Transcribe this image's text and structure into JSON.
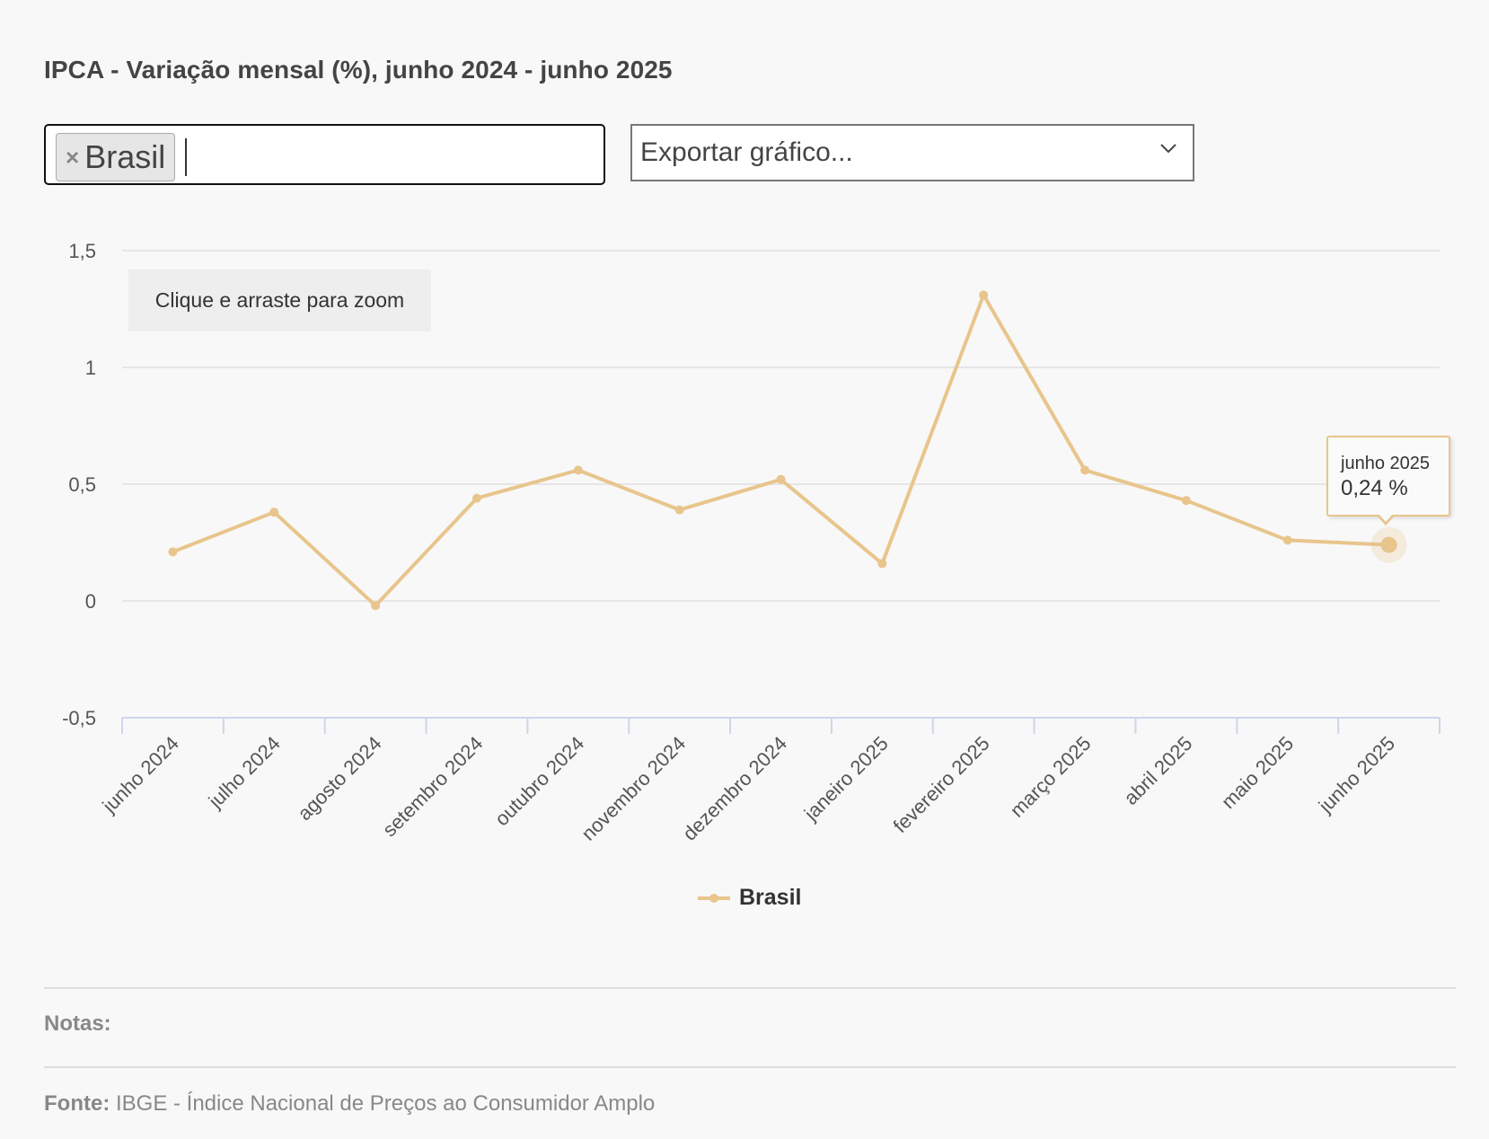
{
  "title": "IPCA - Variação mensal (%), junho 2024 - junho 2025",
  "filter": {
    "remove_glyph": "×",
    "selected_tag": "Brasil"
  },
  "export": {
    "label": "Exportar gráfico..."
  },
  "zoom_hint": "Clique e arraste para zoom",
  "tooltip": {
    "month": "junho 2025",
    "value": "0,24 %"
  },
  "legend": {
    "label": "Brasil"
  },
  "notes_label": "Notas:",
  "source": {
    "label": "Fonte:",
    "text": "IBGE - Índice Nacional de Preços ao Consumidor Amplo"
  },
  "colors": {
    "series": "#e8c58c",
    "grid": "#e6e6e6",
    "axis": "#ccd6eb"
  },
  "chart_data": {
    "type": "line",
    "title": "IPCA - Variação mensal (%), junho 2024 - junho 2025",
    "categories": [
      "junho 2024",
      "julho 2024",
      "agosto 2024",
      "setembro 2024",
      "outubro 2024",
      "novembro 2024",
      "dezembro 2024",
      "janeiro 2025",
      "fevereiro 2025",
      "março 2025",
      "abril 2025",
      "maio 2025",
      "junho 2025"
    ],
    "series": [
      {
        "name": "Brasil",
        "values": [
          0.21,
          0.38,
          -0.02,
          0.44,
          0.56,
          0.39,
          0.52,
          0.16,
          1.31,
          0.56,
          0.43,
          0.26,
          0.24
        ]
      }
    ],
    "ylim": [
      -0.5,
      1.5
    ],
    "yticks": [
      -0.5,
      0,
      0.5,
      1,
      1.5
    ],
    "ytick_labels": [
      "-0,5",
      "0",
      "0,5",
      "1",
      "1,5"
    ],
    "highlighted_index": 12,
    "grid": true,
    "legend_position": "bottom-center"
  }
}
